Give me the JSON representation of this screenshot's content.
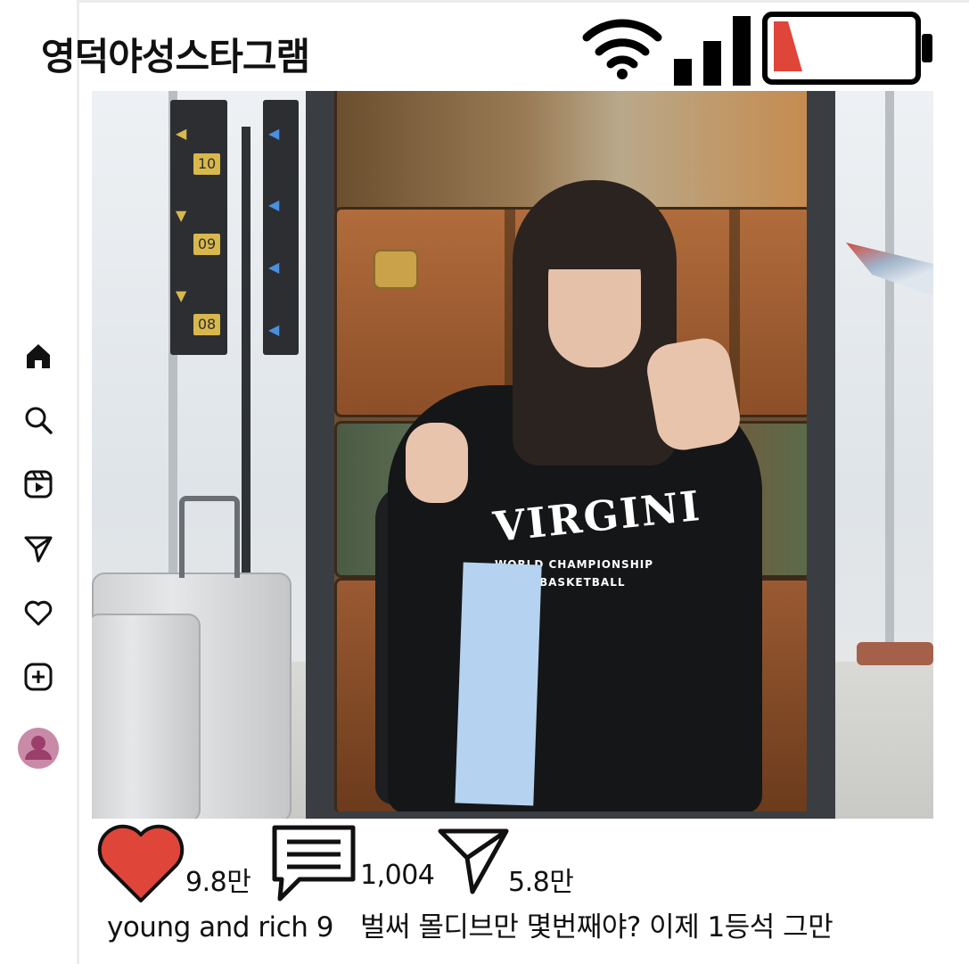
{
  "header": {
    "title": "영덕야성스타그램"
  },
  "status_bar": {
    "wifi_icon": "wifi-icon",
    "signal_icon": "signal-bars-icon",
    "battery_icon": "battery-low-icon",
    "battery_level_fraction": 0.1,
    "battery_fill_color": "#e0453a"
  },
  "sidebar": {
    "items": [
      {
        "icon": "home-icon"
      },
      {
        "icon": "search-icon"
      },
      {
        "icon": "reels-icon"
      },
      {
        "icon": "send-icon"
      },
      {
        "icon": "heart-icon"
      },
      {
        "icon": "add-icon"
      },
      {
        "icon": "profile-avatar-icon"
      }
    ]
  },
  "post": {
    "image": "airport suitcase photo",
    "hoodie_text": "VIRGINI",
    "hoodie_subtext_1": "WORLD CHAMPIONSHIP",
    "hoodie_subtext_2": "BASKETBALL",
    "sign_numbers": [
      "10",
      "09",
      "08"
    ],
    "likes": "9.8만",
    "comments": "1,004",
    "shares": "5.8만",
    "like_color": "#e0453a"
  },
  "caption": {
    "username": "young and rich 9",
    "text": "벌써 몰디브만 몇번째야?  이제 1등석 그만"
  }
}
